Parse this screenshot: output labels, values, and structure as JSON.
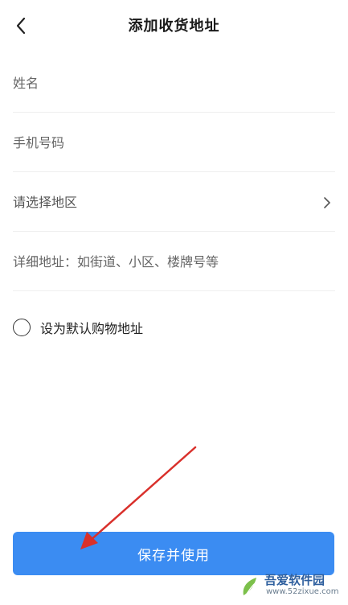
{
  "header": {
    "title": "添加收货地址",
    "back_icon": "chevron-left-icon"
  },
  "form": {
    "name_placeholder": "姓名",
    "phone_placeholder": "手机号码",
    "region_label": "请选择地区",
    "region_icon": "chevron-right-icon",
    "detail_placeholder": "详细地址：如街道、小区、楼牌号等"
  },
  "default_option": {
    "label": "设为默认购物地址",
    "checked": false
  },
  "actions": {
    "save_label": "保存并使用"
  },
  "colors": {
    "primary_button": "#3b8cf2",
    "annotation_arrow": "#d9302b"
  },
  "watermark": {
    "name": "吾爱软件园",
    "url": "www.52zixue.com"
  }
}
